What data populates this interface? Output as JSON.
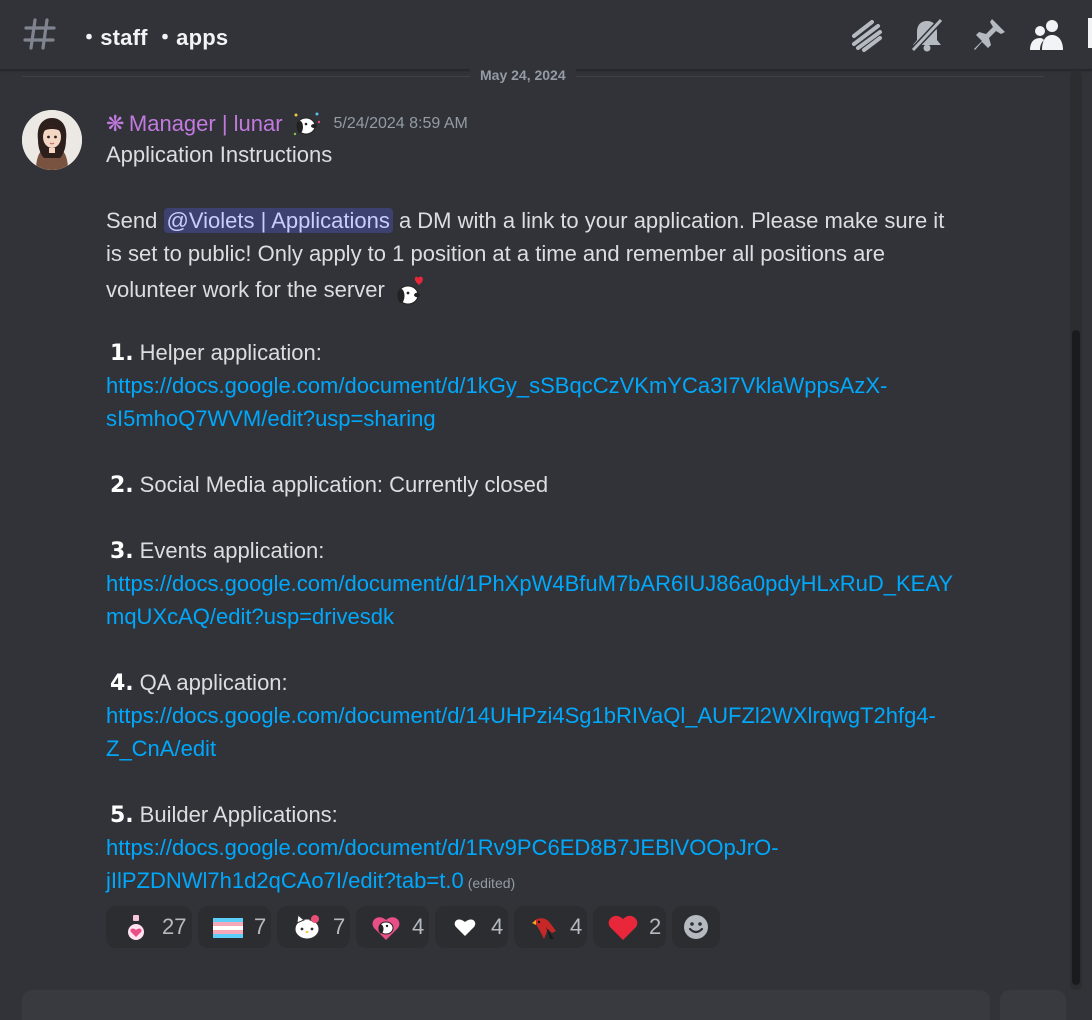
{
  "header": {
    "channel": "・staff ・apps",
    "icons": [
      "threads-icon",
      "mute-bell-icon",
      "pin-icon",
      "members-icon"
    ]
  },
  "date_divider": "May 24, 2024",
  "message": {
    "role_symbol": "❋",
    "author": "Manager | lunar",
    "timestamp": "5/24/2024 8:59 AM",
    "title": "Application Instructions",
    "intro_send": "Send ",
    "mention": "@Violets | Applications",
    "intro_rest_1": " a DM with a link to your application. Please make sure it",
    "intro_line_2": "is set to public! Only apply to 1 position at a time and remember all positions are",
    "intro_line_3": "volunteer work for the server",
    "items": [
      {
        "num": "1.",
        "label": "Helper application:",
        "link_1": "https://docs.google.com/document/d/1kGy_sSBqcCzVKmYCa3I7VklaWppsAzX-",
        "link_2": "sI5mhoQ7WVM/edit?usp=sharing"
      },
      {
        "num": "2.",
        "label": "Social Media application: Currently closed"
      },
      {
        "num": "3.",
        "label": "Events application:",
        "link_1": "https://docs.google.com/document/d/1PhXpW4BfuM7bAR6IUJ86a0pdyHLxRuD_KEAY",
        "link_2": "mqUXcAQ/edit?usp=drivesdk"
      },
      {
        "num": "4.",
        "label": "QA application:",
        "link_1": "https://docs.google.com/document/d/14UHPzi4Sg1bRIVaQl_AUFZl2WXlrqwgT2hfg4-",
        "link_2": "Z_CnA/edit"
      },
      {
        "num": "5.",
        "label": "Builder Applications:",
        "link_1": "https://docs.google.com/document/d/1Rv9PC6ED8B7JEBlVOOpJrO-",
        "link_2": "jIlPZDNWl7h1d2qCAo7I/edit?tab=t.0"
      }
    ],
    "edited": "(edited)"
  },
  "reactions": [
    {
      "emoji": "pink-heart-potion-icon",
      "count": "27"
    },
    {
      "emoji": "trans-flag-icon",
      "count": "7"
    },
    {
      "emoji": "hello-kitty-icon",
      "count": "7"
    },
    {
      "emoji": "snoopy-heart-icon",
      "count": "4"
    },
    {
      "emoji": "white-heart-icon",
      "count": "4"
    },
    {
      "emoji": "red-bird-icon",
      "count": "4"
    },
    {
      "emoji": "red-heart-icon",
      "count": "2"
    }
  ],
  "colors": {
    "background": "#313338",
    "role": "#c27ae0",
    "link": "#00a8fc",
    "mention_bg": "#3c4270",
    "muted": "#949ba4"
  }
}
